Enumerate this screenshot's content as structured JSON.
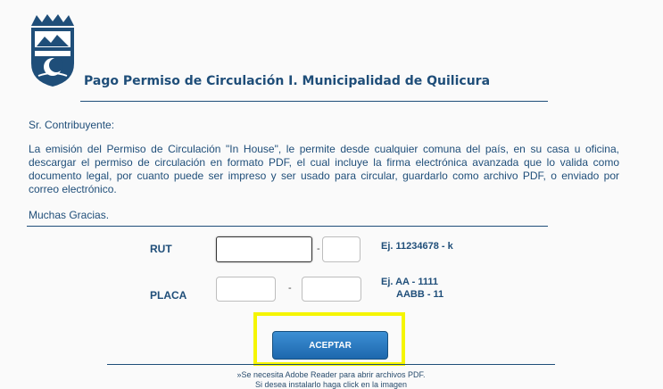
{
  "header": {
    "title": "Pago Permiso de Circulación I. Municipalidad de Quilicura"
  },
  "intro": {
    "greeting": "Sr. Contribuyente:",
    "body": "La emisión del Permiso de Circulación \"In House\", le permite desde cualquier comuna del país, en su casa u oficina, descargar el permiso de circulación en formato PDF, el cual incluye la firma electrónica avanzada que lo valida como documento legal, por cuanto puede ser impreso y ser usado para circular, guardarlo como archivo PDF, o enviado por correo electrónico.",
    "thanks": "Muchas Gracias."
  },
  "form": {
    "rut_label": "RUT",
    "rut_value": "",
    "rut_dv_value": "",
    "separator": "-",
    "rut_hint": "Ej. 11234678 - k",
    "placa_label": "PLACA",
    "placa1_value": "",
    "placa2_value": "",
    "placa_hint_1": "Ej. AA - 1111",
    "placa_hint_2": "AABB - 11",
    "accept_label": "ACEPTAR"
  },
  "footer": {
    "note_1": "»Se necesita Adobe Reader para abrir archivos PDF.",
    "note_2": "Si desea instalarlo haga click en la imagen"
  },
  "colors": {
    "text_blue": "#1f4e79",
    "button_blue": "#2a7bc4",
    "highlight_yellow": "#f5f500"
  }
}
